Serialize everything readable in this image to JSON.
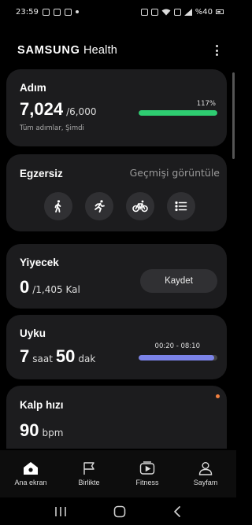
{
  "status_bar": {
    "time": "23:59",
    "battery_text": "%40"
  },
  "header": {
    "brand_bold": "SAMSUNG",
    "brand_regular": "Health"
  },
  "steps": {
    "title": "Adım",
    "value": "7,024",
    "goal": "/6,000",
    "subtitle": "Tüm adımlar, Şimdi",
    "percent_label": "117%",
    "progress": 1.0,
    "bar_color": "#2ecc71"
  },
  "exercise": {
    "title": "Egzersiz",
    "history_link": "Geçmişi görüntüle",
    "buttons": [
      "walk-icon",
      "run-icon",
      "bike-icon",
      "list-icon"
    ]
  },
  "food": {
    "title": "Yiyecek",
    "value": "0",
    "goal": "/1,405 Kal",
    "record_button": "Kaydet"
  },
  "sleep": {
    "title": "Uyku",
    "hours": "7",
    "hours_unit": "saat",
    "minutes": "50",
    "minutes_unit": "dak",
    "time_range": "00:20 - 08:10",
    "progress": 0.96,
    "bar_color": "#7b83e8"
  },
  "heart": {
    "title": "Kalp hızı",
    "value": "90",
    "unit": "bpm",
    "indicator_color": "#f08040"
  },
  "bottom_nav": [
    {
      "label": "Ana ekran",
      "icon": "home-icon",
      "active": true
    },
    {
      "label": "Birlikte",
      "icon": "flag-icon",
      "active": false
    },
    {
      "label": "Fitness",
      "icon": "fitness-play-icon",
      "active": false
    },
    {
      "label": "Sayfam",
      "icon": "profile-icon",
      "active": false
    }
  ]
}
